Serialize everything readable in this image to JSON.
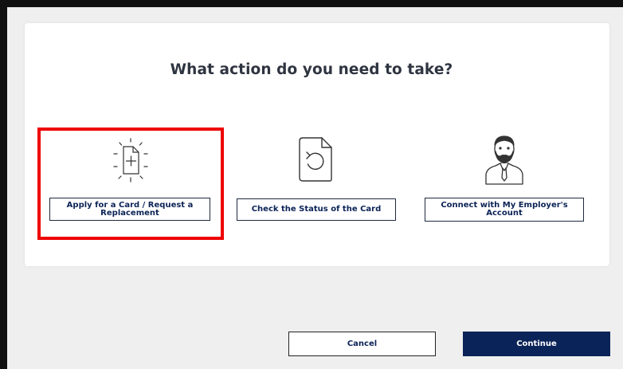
{
  "heading": "What action do you need to take?",
  "options": [
    {
      "label": "Apply for a Card / Request a Replacement",
      "icon": "new-document-icon",
      "selected": true
    },
    {
      "label": "Check the Status of the Card",
      "icon": "document-refresh-icon",
      "selected": false
    },
    {
      "label": "Connect with My Employer's Account",
      "icon": "employer-person-icon",
      "selected": false
    }
  ],
  "footer": {
    "cancel_label": "Cancel",
    "continue_label": "Continue"
  },
  "colors": {
    "primary": "#0a2358",
    "highlight": "#ee0000",
    "heading": "#2e3440"
  }
}
